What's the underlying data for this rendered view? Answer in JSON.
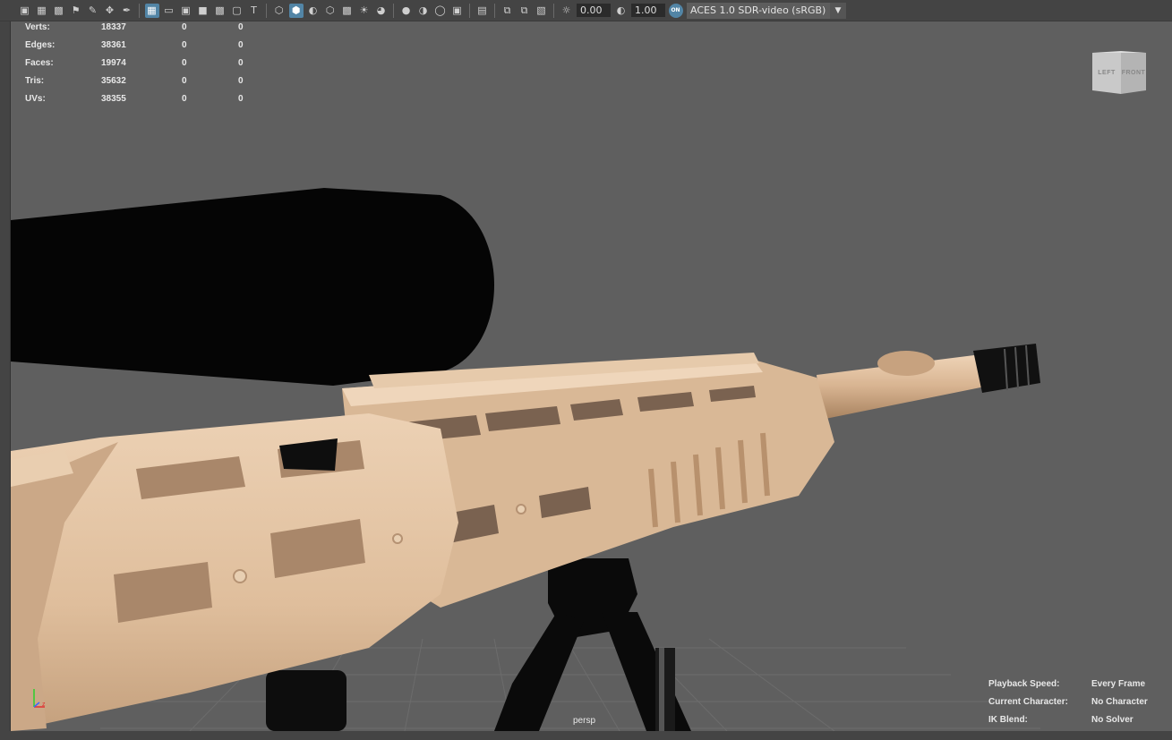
{
  "toolbar": {
    "icons": [
      "camera-select-icon",
      "camera-lock-icon",
      "camera-attributes-icon",
      "bookmark-icon",
      "grease-pencil-icon",
      "2d-pan-zoom-icon",
      "paint-icon",
      "grid-icon",
      "film-gate-icon",
      "resolution-gate-icon",
      "gate-mask-icon",
      "field-chart-icon",
      "safe-action-icon",
      "safe-title-icon",
      "wireframe-icon",
      "smooth-shade-icon",
      "default-material-icon",
      "wireframe-on-shaded-icon",
      "textured-icon",
      "lighting-icon",
      "shadows-icon",
      "screen-space-ao-icon",
      "motion-blur-icon",
      "multisample-aa-icon",
      "depth-of-field-icon",
      "isolate-select-icon",
      "xray-icon",
      "xray-joints-icon",
      "xray-active-icon",
      "exposure-icon",
      "gamma-icon",
      "color-management-icon"
    ],
    "exposure_value": "0.00",
    "gamma_value": "1.00",
    "color_mgmt_badge": "ON",
    "view_transform": "ACES 1.0 SDR-video (sRGB)"
  },
  "hud_stats": [
    {
      "label": "Verts:",
      "total": "18337",
      "selected": "0",
      "component": "0"
    },
    {
      "label": "Edges:",
      "total": "38361",
      "selected": "0",
      "component": "0"
    },
    {
      "label": "Faces:",
      "total": "19974",
      "selected": "0",
      "component": "0"
    },
    {
      "label": "Tris:",
      "total": "35632",
      "selected": "0",
      "component": "0"
    },
    {
      "label": "UVs:",
      "total": "38355",
      "selected": "0",
      "component": "0"
    }
  ],
  "viewcube": {
    "left_label": "LEFT",
    "front_label": "FRONT"
  },
  "camera_name": "persp",
  "hud_bottom_right": [
    {
      "key": "Playback Speed:",
      "value": "Every Frame"
    },
    {
      "key": "Current Character:",
      "value": "No Character"
    },
    {
      "key": "IK Blend:",
      "value": "No Solver"
    }
  ],
  "axis": {
    "x": "x",
    "y": "y",
    "z": "z"
  },
  "colors": {
    "viewport_bg": "#5f5f5f",
    "ui_bg": "#444444",
    "rifle_tan": "#e3c3a2",
    "scope_black": "#050505",
    "accent_blue": "#5285a6"
  }
}
